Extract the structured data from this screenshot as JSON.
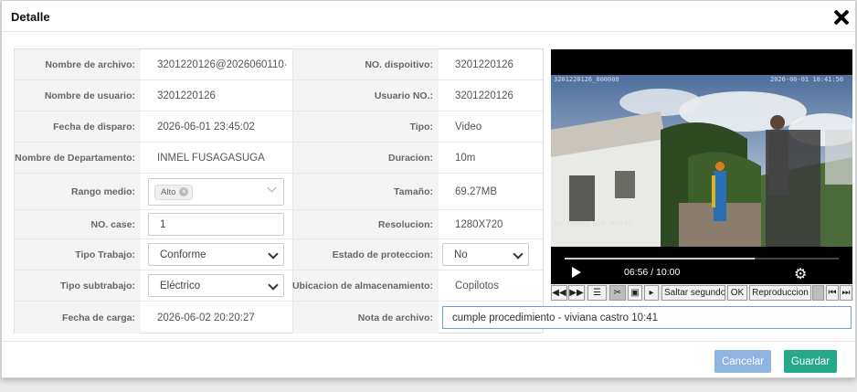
{
  "dialog": {
    "title": "Detalle"
  },
  "form": {
    "nombre_archivo": {
      "label": "Nombre de archivo:",
      "value": "3201220126@2026060110·"
    },
    "dispositivo": {
      "label": "NO. dispoitivo:",
      "value": "3201220126"
    },
    "nombre_usuario": {
      "label": "Nombre de usuario:",
      "value": "3201220126"
    },
    "usuario_no": {
      "label": "Usuario NO.:",
      "value": "3201220126"
    },
    "fecha_disparo": {
      "label": "Fecha de disparo:",
      "value": "2026-06-01 23:45:02"
    },
    "tipo": {
      "label": "Tipo:",
      "value": "Video"
    },
    "departamento": {
      "label": "Nombre de Departamento:",
      "value": "INMEL FUSAGASUGA"
    },
    "duracion": {
      "label": "Duracion:",
      "value": "10m"
    },
    "rango_medio": {
      "label": "Rango medio:",
      "tag": "Alto",
      "tag_remove": "×"
    },
    "tamano": {
      "label": "Tamaño:",
      "value": "69.27MB"
    },
    "no_case": {
      "label": "NO. case:",
      "value": "1"
    },
    "resolucion": {
      "label": "Resolucion:",
      "value": "1280X720"
    },
    "tipo_trabajo": {
      "label": "Tipo Trabajo:",
      "value": "Conforme"
    },
    "estado_proteccion": {
      "label": "Estado de proteccion:",
      "value": "No"
    },
    "tipo_subtrabajo": {
      "label": "Tipo subtrabajo:",
      "value": "Eléctrico"
    },
    "ubicacion": {
      "label": "Ubicacion de almacenamiento:",
      "value": "Copilotos"
    },
    "fecha_carga": {
      "label": "Fecha de carga:",
      "value": "2026-06-02 20:20:27"
    },
    "nota": {
      "label": "Nota de archivo:",
      "value": "cumple procedimiento - viviana castro 10:41"
    }
  },
  "video": {
    "osd_top_left": "3201220126_000000",
    "osd_top_right": "2026-06-01 10:41:50",
    "osd_coords": "N4.289563 W74.466597",
    "time": "06:56 / 10:00",
    "progress": 0.693
  },
  "toolbar": {
    "icons": [
      "rewind-icon",
      "fast-forward-icon",
      "list-icon",
      "cut-icon",
      "frame-icon",
      "step-icon"
    ],
    "cut_label": "✂",
    "seek_input": "Saltar segundos",
    "ok_label": "OK",
    "playback_label": "Reproduccion",
    "prev_label": "⏮",
    "next_label": "⏭"
  },
  "footer": {
    "cancel_label": "Cancelar",
    "save_label": "Guardar"
  },
  "colors": {
    "cancel": "#8fb4e2",
    "save": "#27a88a",
    "focus_border": "#6aa0d8"
  }
}
